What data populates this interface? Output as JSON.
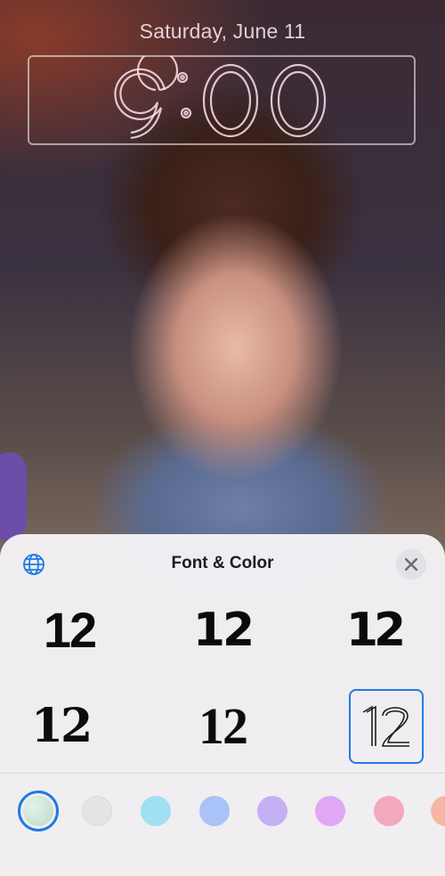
{
  "lockscreen": {
    "date": "Saturday, June 11",
    "time": "9:00"
  },
  "sheet": {
    "title": "Font & Color",
    "globe_icon": "globe-icon",
    "close_icon": "close-icon",
    "fonts": [
      {
        "sample": "12"
      },
      {
        "sample": "12"
      },
      {
        "sample": "12"
      },
      {
        "sample": "12"
      },
      {
        "sample": "12"
      },
      {
        "sample": "12",
        "selected": true
      }
    ],
    "colors": [
      {
        "name": "color-1",
        "hex": "#cfe7d8",
        "selected": true
      },
      {
        "name": "color-2",
        "hex": "#e4e4e7"
      },
      {
        "name": "color-3",
        "hex": "#9fe0f2"
      },
      {
        "name": "color-4",
        "hex": "#a9c2f7"
      },
      {
        "name": "color-5",
        "hex": "#c3b0f5"
      },
      {
        "name": "color-6",
        "hex": "#e0a7f4"
      },
      {
        "name": "color-7",
        "hex": "#f4a8bd"
      },
      {
        "name": "color-8",
        "hex": "#f7b6a3"
      }
    ],
    "accent": "#1e7ae6"
  }
}
